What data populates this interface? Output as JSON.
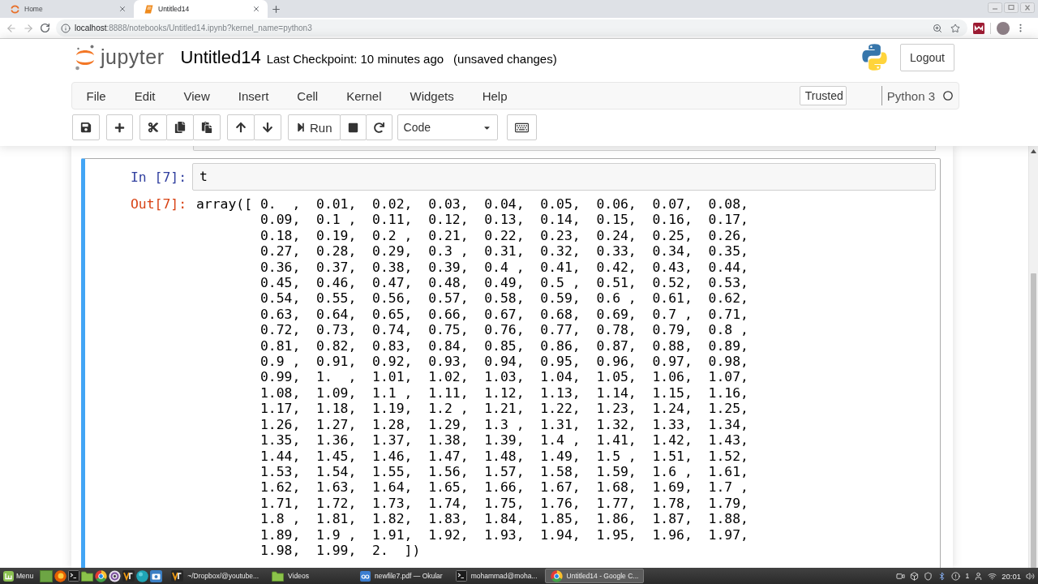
{
  "browser": {
    "tabs": [
      {
        "kind": "home",
        "title": "Home",
        "selected": false
      },
      {
        "kind": "notebook",
        "title": "Untitled14",
        "selected": true
      }
    ],
    "url": {
      "host": "localhost",
      "path": ":8888/notebooks/Untitled14.ipynb?kernel_name=python3"
    }
  },
  "header": {
    "logo_text": "jupyter",
    "notebook_name": "Untitled14",
    "checkpoint": "Last Checkpoint: 10 minutes ago",
    "save_status": "(unsaved changes)",
    "logout": "Logout"
  },
  "menubar": {
    "items": [
      "File",
      "Edit",
      "View",
      "Insert",
      "Cell",
      "Kernel",
      "Widgets",
      "Help"
    ],
    "trusted": "Trusted",
    "kernel_name": "Python 3",
    "kernel_busy": false
  },
  "toolbar": {
    "run_label": "Run",
    "cell_type": "Code"
  },
  "cell": {
    "selected": true,
    "input_prompt": "In [7]:",
    "source": "t",
    "output_prompt": "Out[7]:",
    "output_prefix": "array([",
    "output_lines": [
      "0.  ,  0.01,  0.02,  0.03,  0.04,  0.05,  0.06,  0.07,  0.08,",
      "0.09,  0.1 ,  0.11,  0.12,  0.13,  0.14,  0.15,  0.16,  0.17,",
      "0.18,  0.19,  0.2 ,  0.21,  0.22,  0.23,  0.24,  0.25,  0.26,",
      "0.27,  0.28,  0.29,  0.3 ,  0.31,  0.32,  0.33,  0.34,  0.35,",
      "0.36,  0.37,  0.38,  0.39,  0.4 ,  0.41,  0.42,  0.43,  0.44,",
      "0.45,  0.46,  0.47,  0.48,  0.49,  0.5 ,  0.51,  0.52,  0.53,",
      "0.54,  0.55,  0.56,  0.57,  0.58,  0.59,  0.6 ,  0.61,  0.62,",
      "0.63,  0.64,  0.65,  0.66,  0.67,  0.68,  0.69,  0.7 ,  0.71,",
      "0.72,  0.73,  0.74,  0.75,  0.76,  0.77,  0.78,  0.79,  0.8 ,",
      "0.81,  0.82,  0.83,  0.84,  0.85,  0.86,  0.87,  0.88,  0.89,",
      "0.9 ,  0.91,  0.92,  0.93,  0.94,  0.95,  0.96,  0.97,  0.98,",
      "0.99,  1.  ,  1.01,  1.02,  1.03,  1.04,  1.05,  1.06,  1.07,",
      "1.08,  1.09,  1.1 ,  1.11,  1.12,  1.13,  1.14,  1.15,  1.16,",
      "1.17,  1.18,  1.19,  1.2 ,  1.21,  1.22,  1.23,  1.24,  1.25,",
      "1.26,  1.27,  1.28,  1.29,  1.3 ,  1.31,  1.32,  1.33,  1.34,",
      "1.35,  1.36,  1.37,  1.38,  1.39,  1.4 ,  1.41,  1.42,  1.43,",
      "1.44,  1.45,  1.46,  1.47,  1.48,  1.49,  1.5 ,  1.51,  1.52,",
      "1.53,  1.54,  1.55,  1.56,  1.57,  1.58,  1.59,  1.6 ,  1.61,",
      "1.62,  1.63,  1.64,  1.65,  1.66,  1.67,  1.68,  1.69,  1.7 ,",
      "1.71,  1.72,  1.73,  1.74,  1.75,  1.76,  1.77,  1.78,  1.79,",
      "1.8 ,  1.81,  1.82,  1.83,  1.84,  1.85,  1.86,  1.87,  1.88,",
      "1.89,  1.9 ,  1.91,  1.92,  1.93,  1.94,  1.95,  1.96,  1.97,",
      "1.98,  1.99,  2.  ])"
    ]
  },
  "taskbar": {
    "menu_label": "Menu",
    "windows": [
      {
        "kind": "app",
        "title": "~/Dropbox/@youtube...",
        "selected": false
      },
      {
        "kind": "folder",
        "title": "Videos",
        "selected": false
      },
      {
        "kind": "document",
        "title": "newfile7.pdf  — Okular",
        "selected": false
      },
      {
        "kind": "terminal",
        "title": "mohammad@moha...",
        "selected": false
      },
      {
        "kind": "browser",
        "title": "Untitled14 - Google C...",
        "selected": true
      }
    ],
    "notification_count": "1",
    "clock": "20:01"
  }
}
